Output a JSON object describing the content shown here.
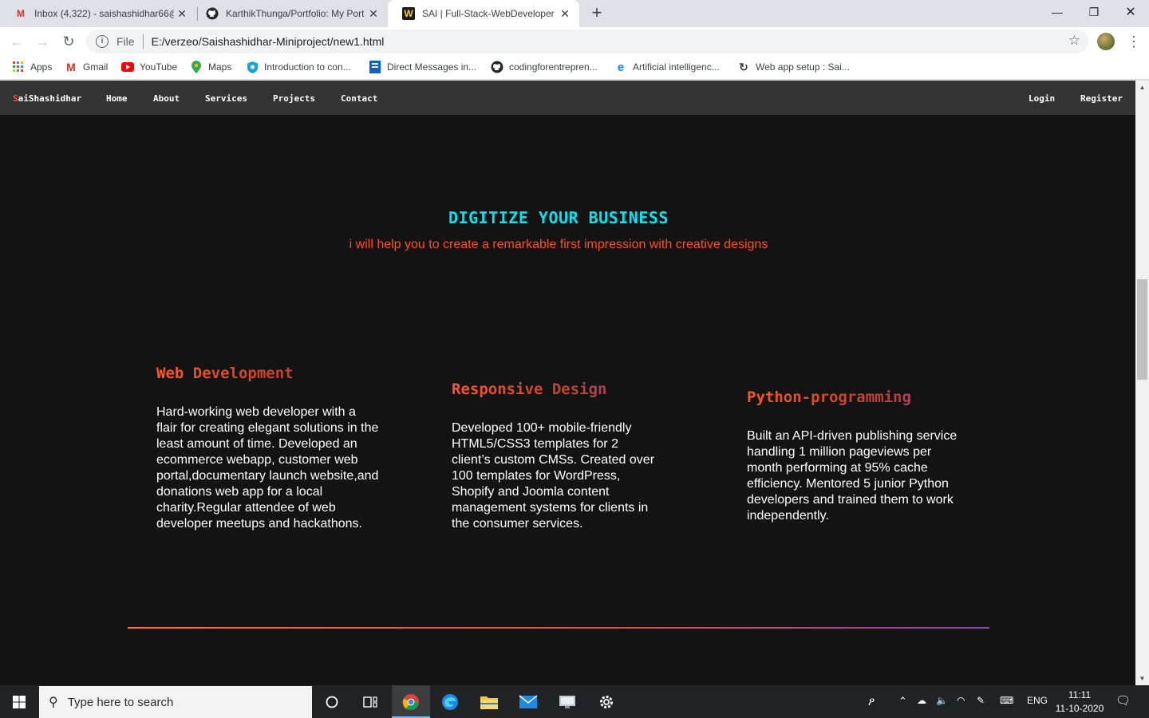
{
  "browser": {
    "tabs": [
      {
        "title": "Inbox (4,322) - saishashidhar66@",
        "icon": "gmail-icon",
        "active": false
      },
      {
        "title": "KarthikThunga/Portfolio: My Port",
        "icon": "github-icon",
        "active": false
      },
      {
        "title": "SAI | Full-Stack-WebDeveloper",
        "icon": "site-icon",
        "active": true
      }
    ],
    "new_tab": "+",
    "address": {
      "scheme": "File",
      "url": "E:/verzeo/Saishashidhar-Miniproject/new1.html"
    },
    "bookmarks": [
      {
        "label": "Apps",
        "icon": "apps-grid-icon"
      },
      {
        "label": "Gmail",
        "icon": "gmail-icon"
      },
      {
        "label": "YouTube",
        "icon": "youtube-icon"
      },
      {
        "label": "Maps",
        "icon": "maps-icon"
      },
      {
        "label": "Introduction to con...",
        "icon": "shield-icon"
      },
      {
        "label": "Direct Messages in...",
        "icon": "bookmark-icon"
      },
      {
        "label": "codingforentrepren...",
        "icon": "github-icon"
      },
      {
        "label": "Artificial intelligenc...",
        "icon": "edge-icon"
      },
      {
        "label": "Web app setup : Sai...",
        "icon": "loading-icon"
      }
    ]
  },
  "site": {
    "nav": {
      "brand_first": "S",
      "brand_rest": "aiShashidhar",
      "links": [
        "Home",
        "About",
        "Services",
        "Projects",
        "Contact"
      ],
      "login": "Login",
      "register": "Register"
    },
    "hero": {
      "title": "DIGITIZE YOUR BUSINESS",
      "subtitle": "i will help you to create a remarkable first impression with creative designs"
    },
    "services": [
      {
        "title": "Web Development",
        "text": "Hard-working web developer with a flair for creating elegant solutions in the least amount of time. Developed an ecommerce webapp, customer web portal,documentary launch website,and donations web app for a local charity.Regular attendee of web developer meetups and hackathons."
      },
      {
        "title": "Responsive Design",
        "text": "Developed 100+ mobile-friendly HTML5/CSS3 templates for 2 client’s custom CMSs. Created over 100 templates for WordPress, Shopify and Joomla content management systems for clients in the consumer services."
      },
      {
        "title": "Python-programming",
        "text": "Built an API-driven publishing service handling 1 million pageviews per month performing at 95% cache efficiency. Mentored 5 junior Python developers and trained them to work independently."
      }
    ]
  },
  "taskbar": {
    "search_placeholder": "Type here to search",
    "language": "ENG",
    "time": "11:11",
    "date": "11-10-2020"
  },
  "colors": {
    "hero_title": "#00e5f2",
    "hero_subtitle": "#ff4e1f",
    "page_bg": "#141313",
    "navbar_bg": "#333333"
  }
}
